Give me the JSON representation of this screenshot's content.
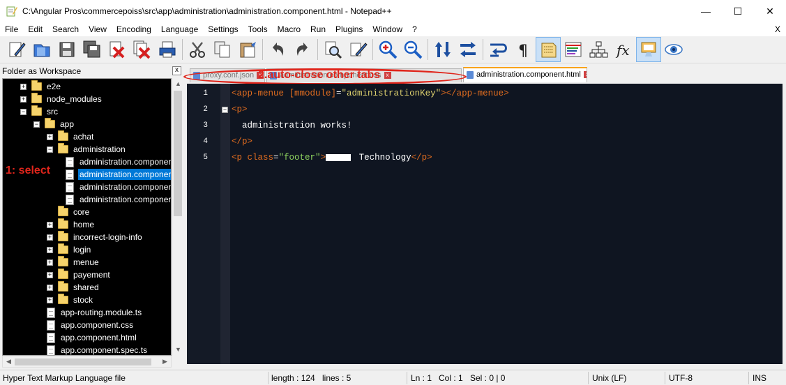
{
  "window": {
    "title": "C:\\Angular Pros\\commercepoiss\\src\\app\\administration\\administration.component.html - Notepad++",
    "min_glyph": "—",
    "max_glyph": "☐",
    "close_glyph": "✕"
  },
  "menu": {
    "items": [
      "File",
      "Edit",
      "Search",
      "View",
      "Encoding",
      "Language",
      "Settings",
      "Tools",
      "Macro",
      "Run",
      "Plugins",
      "Window",
      "?"
    ],
    "close": "X"
  },
  "toolbar": {
    "buttons": [
      "new-file-icon",
      "open-file-icon",
      "save-icon",
      "save-all-icon",
      "close-icon",
      "close-all-icon",
      "print-icon",
      "cut-icon",
      "copy-icon",
      "paste-icon",
      "undo-icon",
      "redo-icon",
      "find-icon",
      "replace-icon",
      "zoom-in-icon",
      "zoom-out-icon",
      "sync-vertical-icon",
      "sync-horizontal-icon",
      "word-wrap-icon",
      "show-all-chars-icon",
      "indent-guide-icon",
      "language-icon",
      "document-map-icon",
      "function-list-icon",
      "folder-workspace-icon",
      "monitoring-icon"
    ],
    "active": "folder-workspace-icon"
  },
  "panel": {
    "title": "Folder as Workspace",
    "close_glyph": "x",
    "tree": [
      {
        "label": "e2e",
        "type": "folder",
        "depth": 1,
        "expanded": false
      },
      {
        "label": "node_modules",
        "type": "folder",
        "depth": 1,
        "expanded": false
      },
      {
        "label": "src",
        "type": "folder",
        "depth": 1,
        "expanded": true
      },
      {
        "label": "app",
        "type": "folder",
        "depth": 2,
        "expanded": true
      },
      {
        "label": "achat",
        "type": "folder",
        "depth": 3,
        "expanded": false
      },
      {
        "label": "administration",
        "type": "folder",
        "depth": 3,
        "expanded": true
      },
      {
        "label": "administration.component.css",
        "type": "file",
        "depth": 4
      },
      {
        "label": "administration.component.html",
        "type": "file",
        "depth": 4,
        "selected": true
      },
      {
        "label": "administration.component.spec.ts",
        "type": "file",
        "depth": 4
      },
      {
        "label": "administration.component.ts",
        "type": "file",
        "depth": 4
      },
      {
        "label": "core",
        "type": "folder",
        "depth": 3,
        "expanded": null
      },
      {
        "label": "home",
        "type": "folder",
        "depth": 3,
        "expanded": false
      },
      {
        "label": "incorrect-login-info",
        "type": "folder",
        "depth": 3,
        "expanded": false
      },
      {
        "label": "login",
        "type": "folder",
        "depth": 3,
        "expanded": false
      },
      {
        "label": "menue",
        "type": "folder",
        "depth": 3,
        "expanded": false
      },
      {
        "label": "payement",
        "type": "folder",
        "depth": 3,
        "expanded": false
      },
      {
        "label": "shared",
        "type": "folder",
        "depth": 3,
        "expanded": false
      },
      {
        "label": "stock",
        "type": "folder",
        "depth": 3,
        "expanded": false
      },
      {
        "label": "app-routing.module.ts",
        "type": "file",
        "depth": 3
      },
      {
        "label": "app.component.css",
        "type": "file",
        "depth": 3
      },
      {
        "label": "app.component.html",
        "type": "file",
        "depth": 3
      },
      {
        "label": "app.component.spec.ts",
        "type": "file",
        "depth": 3
      }
    ]
  },
  "annotations": {
    "select": "1: select",
    "tabs": "2.auto-close other tabs"
  },
  "tabs": [
    {
      "label": "proxy.conf.json",
      "active": false
    },
    {
      "label": "administration.component.css",
      "active": false
    },
    {
      "label": "administration.component.html",
      "active": true
    }
  ],
  "editor": {
    "lines": [
      {
        "n": "1",
        "fold": false
      },
      {
        "n": "2",
        "fold": true
      },
      {
        "n": "3",
        "fold": false
      },
      {
        "n": "4",
        "fold": false
      },
      {
        "n": "5",
        "fold": false
      }
    ],
    "line1": {
      "open": "<app-menue ",
      "attr": "[mmodule]",
      "eq": "=",
      "val": "\"administrationKey\"",
      "close": "></app-menue>"
    },
    "line2": {
      "tag": "<p>"
    },
    "line3": {
      "text": "  administration works!"
    },
    "line4": {
      "tag": "</p>"
    },
    "line5": {
      "open": "<p ",
      "attr": "class",
      "eq": "=",
      "val": "\"footer\"",
      "gt": ">",
      "text": " Technology",
      "close": "</p>"
    }
  },
  "status": {
    "language": "Hyper Text Markup Language file",
    "length": "length : 124",
    "lines": "lines : 5",
    "ln": "Ln : 1",
    "col": "Col : 1",
    "sel": "Sel : 0 | 0",
    "eol": "Unix (LF)",
    "encoding": "UTF-8",
    "mode": "INS"
  }
}
